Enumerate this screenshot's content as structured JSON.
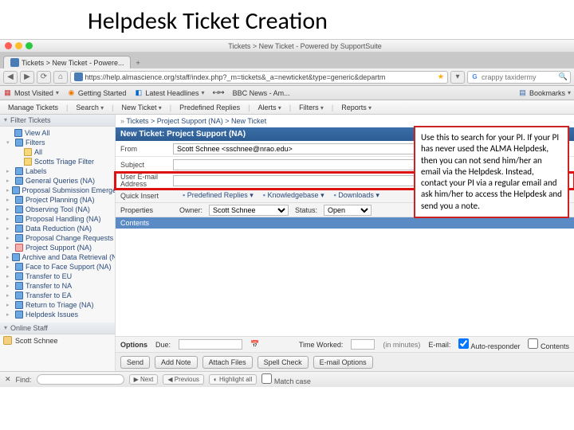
{
  "slide": {
    "title": "Helpdesk Ticket Creation"
  },
  "window": {
    "title": "Tickets > New Ticket - Powered by SupportSuite"
  },
  "tab": {
    "label": "Tickets > New Ticket - Powere..."
  },
  "url": "https://help.almascience.org/staff/index.php?_m=tickets&_a=newticket&type=generic&departm",
  "search": {
    "placeholder": "crappy taxidermy"
  },
  "bookmarks": {
    "most": "Most Visited",
    "gs": "Getting Started",
    "lh": "Latest Headlines",
    "bbc": "BBC News - Am...",
    "bmk": "Bookmarks"
  },
  "menus": [
    "Manage Tickets",
    "Search",
    "New Ticket",
    "Predefined Replies",
    "Alerts",
    "Filters",
    "Reports"
  ],
  "sidebar": {
    "filter_hdr": "Filter Tickets",
    "items": [
      "View All",
      "Filters",
      "All",
      "Scotts Triage Filter",
      "Labels",
      "General Queries (NA)",
      "Proposal Submission Emergency",
      "Project Planning (NA)",
      "Observing Tool (NA)",
      "Proposal Handling (NA)",
      "Data Reduction (NA)",
      "Proposal Change Requests",
      "Project Support (NA)",
      "Archive and Data Retrieval (NA)",
      "Face to Face Support (NA)",
      "Transfer to EU",
      "Transfer to NA",
      "Transfer to EA",
      "Return to Triage (NA)",
      "Helpdesk Issues"
    ],
    "staff_hdr": "Online Staff",
    "staff": "Scott Schnee"
  },
  "crumb": "Tickets > Project Support (NA) > New Ticket",
  "ticket_head": "New Ticket: Project Support (NA)",
  "form": {
    "from_lbl": "From",
    "from_val": "Scott Schnee <sschnee@nrao.edu>",
    "subj_lbl": "Subject",
    "email_lbl": "User E-mail Address",
    "qi_lbl": "Quick Insert",
    "qi_pr": "Predefined Replies",
    "qi_kb": "Knowledgebase",
    "qi_dl": "Downloads",
    "prop_lbl": "Properties",
    "owner_lbl": "Owner:",
    "owner": "Scott Schnee",
    "status_lbl": "Status:",
    "status": "Open",
    "contents": "Contents"
  },
  "opts": {
    "lbl": "Options",
    "due": "Due:",
    "tw": "Time Worked:",
    "tw_unit": "(in minutes)",
    "email": "E-mail:",
    "ar": "Auto-responder",
    "ct": "Contents"
  },
  "btns": {
    "send": "Send",
    "note": "Add Note",
    "attach": "Attach Files",
    "spell": "Spell Check",
    "opt": "E-mail Options"
  },
  "callout": "Use this to search for your PI. If your PI has never used the ALMA Helpdesk, then you can not send him/her an email via the Helpdesk. Instead, contact your PI via a regular email and ask him/her to access the Helpdesk and send you a note.",
  "find": {
    "lbl": "Find:",
    "next": "Next",
    "prev": "Previous",
    "hl": "Highlight all",
    "mc": "Match case"
  }
}
